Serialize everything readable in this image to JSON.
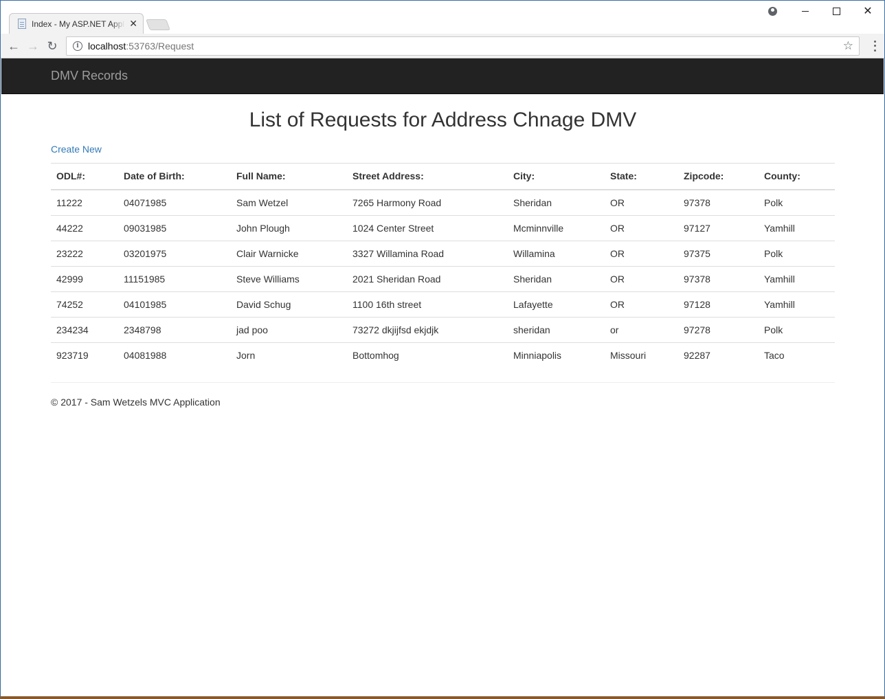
{
  "browser": {
    "tab_title": "Index - My ASP.NET Appl",
    "tab_close": "✕",
    "url_host": "localhost",
    "url_path": ":53763/Request",
    "back_icon": "←",
    "forward_icon": "→",
    "reload_icon": "↻",
    "star_icon": "☆",
    "close_icon": "✕"
  },
  "navbar": {
    "brand": "DMV Records"
  },
  "main": {
    "title": "List of Requests for Address Chnage DMV",
    "create_link": "Create New"
  },
  "table": {
    "headers": [
      "ODL#:",
      "Date of Birth:",
      "Full Name:",
      "Street Address:",
      "City:",
      "State:",
      "Zipcode:",
      "County:"
    ],
    "rows": [
      [
        "11222",
        "04071985",
        "Sam Wetzel",
        "7265 Harmony Road",
        "Sheridan",
        "OR",
        "97378",
        "Polk"
      ],
      [
        "44222",
        "09031985",
        "John Plough",
        "1024 Center Street",
        "Mcminnville",
        "OR",
        "97127",
        "Yamhill"
      ],
      [
        "23222",
        "03201975",
        "Clair Warnicke",
        "3327 Willamina Road",
        "Willamina",
        "OR",
        "97375",
        "Polk"
      ],
      [
        "42999",
        "11151985",
        "Steve Williams",
        "2021 Sheridan Road",
        "Sheridan",
        "OR",
        "97378",
        "Yamhill"
      ],
      [
        "74252",
        "04101985",
        "David Schug",
        "1100 16th street",
        "Lafayette",
        "OR",
        "97128",
        "Yamhill"
      ],
      [
        "234234",
        "2348798",
        "jad poo",
        "73272 dkjijfsd ekjdjk",
        "sheridan",
        "or",
        "97278",
        "Polk"
      ],
      [
        "923719",
        "04081988",
        "Jorn",
        "Bottomhog",
        "Minniapolis",
        "Missouri",
        "92287",
        "Taco"
      ]
    ]
  },
  "footer": {
    "text": "© 2017 - Sam Wetzels MVC Application"
  },
  "colors": {
    "navbar_bg": "#222222",
    "brand": "#9d9d9d",
    "link": "#337ab7",
    "text": "#333333"
  }
}
